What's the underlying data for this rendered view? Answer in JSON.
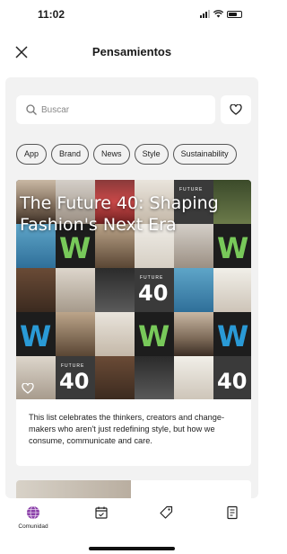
{
  "status_bar": {
    "time": "11:02"
  },
  "header": {
    "title": "Pensamientos",
    "close_icon": "close-icon"
  },
  "search": {
    "placeholder": "Buscar",
    "icon": "search-icon"
  },
  "favorites": {
    "icon": "heart-icon"
  },
  "chips": [
    {
      "label": "App"
    },
    {
      "label": "Brand"
    },
    {
      "label": "News"
    },
    {
      "label": "Style"
    },
    {
      "label": "Sustainability"
    }
  ],
  "article": {
    "title": "The Future 40: Shaping Fashion's Next Era",
    "description": "This list celebrates the thinkers, creators and change-makers who aren't just redefining style, but how we consume, communicate and care.",
    "heart_icon": "heart-outline-icon",
    "tile_labels": {
      "small": "FUTURE",
      "big": "40"
    }
  },
  "tabbar": {
    "items": [
      {
        "label": "Comunidad",
        "icon": "globe-icon",
        "active": true
      },
      {
        "label": "",
        "icon": "calendar-icon"
      },
      {
        "label": "",
        "icon": "tag-icon"
      },
      {
        "label": "",
        "icon": "document-icon"
      }
    ]
  },
  "colors": {
    "accent": "#8a3fa8",
    "background": "#f2f2f2"
  }
}
